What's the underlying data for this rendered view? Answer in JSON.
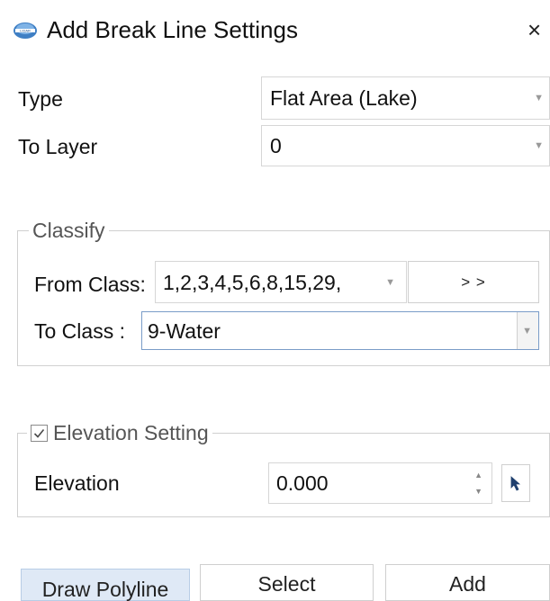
{
  "window": {
    "title": "Add Break Line Settings",
    "close_glyph": "×",
    "logo_icon": "app-logo-icon"
  },
  "type": {
    "label": "Type",
    "value": "Flat Area (Lake)"
  },
  "to_layer": {
    "label": "To Layer",
    "value": "0"
  },
  "classify": {
    "legend": "Classify",
    "from_label": "From Class:",
    "from_value": "1,2,3,4,5,6,8,15,29,",
    "transfer_label": "> >",
    "to_label": "To Class :",
    "to_value": "9-Water"
  },
  "elevation": {
    "legend": "Elevation Setting",
    "checked": true,
    "label": "Elevation",
    "value": "0.000",
    "picker_icon": "pick-arrow-icon"
  },
  "buttons": {
    "draw_polyline": "Draw Polyline",
    "select": "Select",
    "add": "Add"
  },
  "colors": {
    "active_button_bg": "#dfe9f6",
    "accent": "#4a78b5"
  }
}
